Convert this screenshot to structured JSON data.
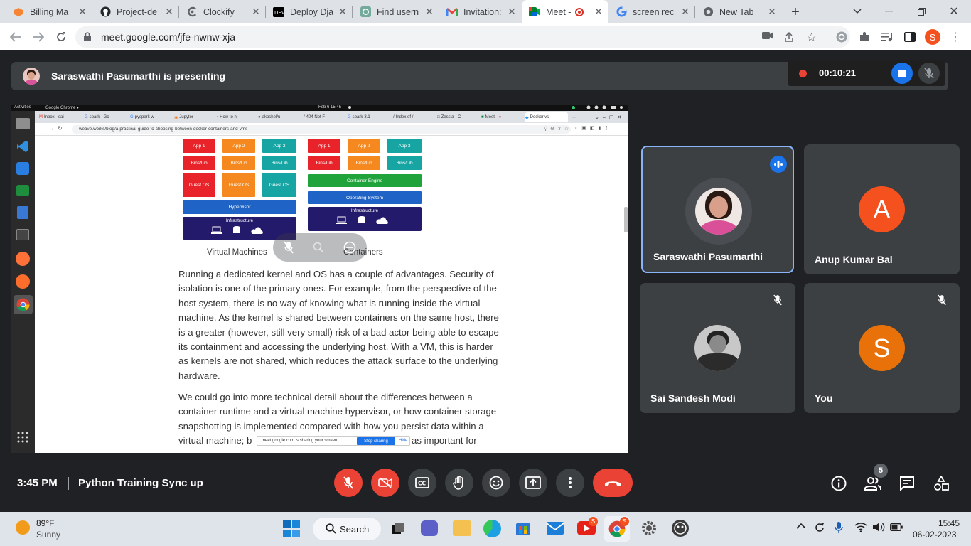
{
  "browser": {
    "tabs": [
      {
        "title": "Billing Ma",
        "icon": "aws-icon"
      },
      {
        "title": "Project-de",
        "icon": "github-icon"
      },
      {
        "title": "Clockify",
        "icon": "clockify-icon"
      },
      {
        "title": "Deploy Dja",
        "icon": "dev-icon"
      },
      {
        "title": "Find usern",
        "icon": "chatgpt-icon"
      },
      {
        "title": "Invitation:",
        "icon": "gmail-icon"
      },
      {
        "title": "Meet - ",
        "icon": "meet-icon"
      },
      {
        "title": "screen rec",
        "icon": "google-icon"
      },
      {
        "title": "New Tab",
        "icon": "chrome-icon"
      }
    ],
    "url": "meet.google.com/jfe-nwnw-xja",
    "profile_initial": "S"
  },
  "meet": {
    "presenting_text": "Saraswathi Pasumarthi is presenting",
    "recording_time": "00:10:21",
    "time": "3:45 PM",
    "meeting_name": "Python Training Sync up",
    "people_count": "5",
    "participants": [
      {
        "name": "Saraswathi Pasumarthi"
      },
      {
        "name": "Anup Kumar Bal",
        "initial": "A"
      },
      {
        "name": "Sai Sandesh Modi"
      },
      {
        "name": "You",
        "initial": "S"
      }
    ]
  },
  "shared_screen": {
    "topbar": {
      "activities": "Activities",
      "app": "Google Chrome ▾",
      "datetime": "Feb 6  15:45"
    },
    "tabs": [
      "Inbox - sai",
      "spark - Go",
      "pyspark w",
      "Jupyter",
      "How to n",
      "akoshel/u",
      "404 Not F",
      "spark-3.1",
      "Index of /",
      "Zessta - C",
      "Meet - ",
      "Docker vs"
    ],
    "url": "weave.works/blog/a-practical-guide-to-choosing-between-docker-containers-and-vms",
    "diagram": {
      "vm_apps": [
        "App 1",
        "App 2",
        "App 3"
      ],
      "vm_bins": [
        "Bins/Lib",
        "Bins/Lib",
        "Bins/Lib"
      ],
      "vm_guest": [
        "Guest OS",
        "Guest OS",
        "Guest OS"
      ],
      "hypervisor": "Hypervisor",
      "infrastructure": "Infrastructure",
      "ct_apps": [
        "App 1",
        "App 2",
        "App 3"
      ],
      "ct_bins": [
        "Bins/Lib",
        "Bins/Lib",
        "Bins/Lib"
      ],
      "container_engine": "Container Engine",
      "operating_system": "Operating System",
      "vm_caption": "Virtual Machines",
      "ct_caption": "Containers"
    },
    "paragraph1_lines": [
      "Running a dedicated kernel and OS has a couple of advantages. Security of",
      "isolation is one of the primary ones. For example, from the perspective of the",
      "host system, there is no way of knowing what is running inside the virtual",
      "machine. As the kernel is shared between containers on the same host, there",
      "is a greater (however, still very small) risk of a bad actor being able to escape",
      "its containment and accessing the underlying host. With a VM, this is harder",
      "as kernels are not shared, which reduces the attack surface to the underlying",
      "hardware."
    ],
    "paragraph2_lines": [
      "We could go into more technical detail about the differences between a",
      "container runtime and a virtual machine hypervisor, or how container storage",
      "snapshotting is implemented compared with how you persist data within a",
      "virtual machine; b",
      "as important for"
    ],
    "sharing_bar": {
      "text": "meet.google.com is sharing your screen.",
      "stop": "Stop sharing",
      "hide": "Hide"
    }
  },
  "taskbar": {
    "weather_temp": "89°F",
    "weather_desc": "Sunny",
    "search": "Search",
    "clock_time": "15:45",
    "clock_date": "06-02-2023"
  },
  "colors": {
    "accent_blue": "#1a73e8",
    "danger_red": "#ea4335",
    "avatar_orange": "#f4511e",
    "you_orange": "#e8710a"
  }
}
